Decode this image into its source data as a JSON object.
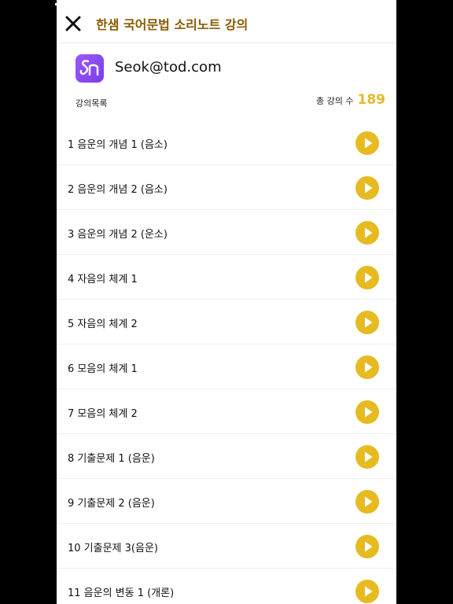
{
  "header": {
    "title": "한샘 국어문법 소리노트 강의",
    "close_icon": "close-icon"
  },
  "account": {
    "logo_icon": "app-logo-icon",
    "email": "Seok@tod.com"
  },
  "summary": {
    "list_label": "강의목록",
    "total_label": "총 강의 수",
    "total_count": "189"
  },
  "colors": {
    "title": "#8a5a00",
    "accent": "#e6bb21",
    "logo": "#8b4dff"
  },
  "lectures": [
    {
      "title": "1 음운의 개념 1 (음소)"
    },
    {
      "title": "2 음운의 개념 2 (음소)"
    },
    {
      "title": "3 음운의 개념 2 (운소)"
    },
    {
      "title": "4 자음의 체계 1"
    },
    {
      "title": "5 자음의 체계 2"
    },
    {
      "title": "6 모음의 체계 1"
    },
    {
      "title": "7 모음의 체계 2"
    },
    {
      "title": "8 기출문제 1 (음운)"
    },
    {
      "title": "9 기출문제 2 (음운)"
    },
    {
      "title": "10 기출문제 3(음운)"
    },
    {
      "title": "11 음운의 변동 1 (개론)"
    }
  ]
}
